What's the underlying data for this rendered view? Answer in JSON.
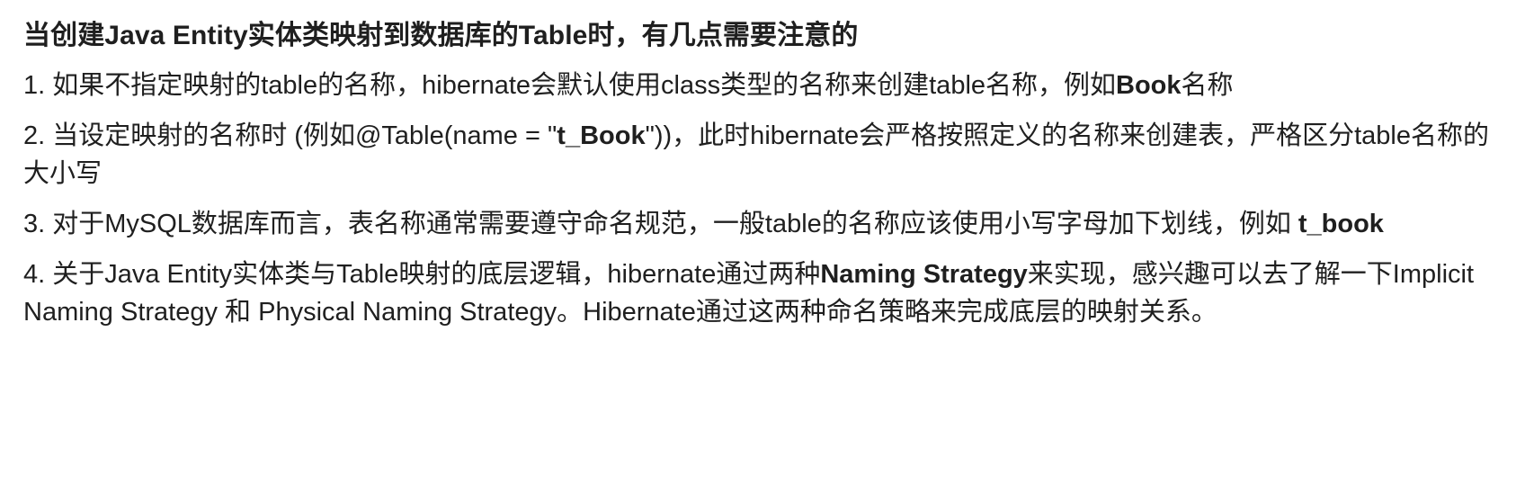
{
  "title": "当创建Java Entity实体类映射到数据库的Table时，有几点需要注意的",
  "items": [
    {
      "parts": [
        {
          "text": "1. 如果不指定映射的table的名称，hibernate会默认使用class类型的名称来创建table名称，例如"
        },
        {
          "text": "Book"
        },
        {
          "text": "名称"
        }
      ]
    },
    {
      "parts": [
        {
          "text": "2. 当设定映射的名称时 (例如@Table(name = \""
        },
        {
          "text": "t_Book"
        },
        {
          "text": "\"))，此时hibernate会严格按照定义的名称来创建表，严格区分table名称的大小写"
        }
      ]
    },
    {
      "parts": [
        {
          "text": "3. 对于MySQL数据库而言，表名称通常需要遵守命名规范，一般table的名称应该使用小写字母加下划线，例如 "
        },
        {
          "text": "t_book"
        }
      ]
    },
    {
      "parts": [
        {
          "text": "4. 关于Java Entity实体类与Table映射的底层逻辑，hibernate通过两种"
        },
        {
          "text": "Naming Strategy"
        },
        {
          "text": "来实现，感兴趣可以去了解一下Implicit Naming Strategy 和 Physical Naming Strategy。Hibernate通过这两种命名策略来完成底层的映射关系。"
        }
      ]
    }
  ]
}
